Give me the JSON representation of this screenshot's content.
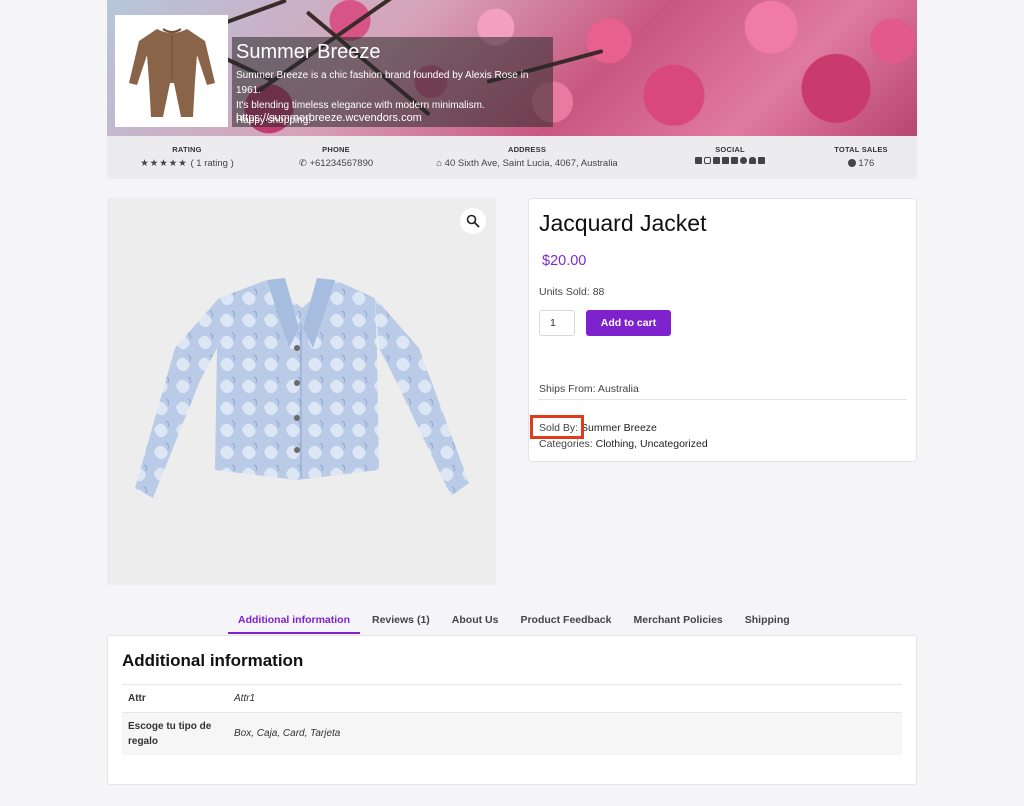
{
  "store": {
    "name": "Summer Breeze",
    "description_lines": [
      " Summer Breeze is a chic fashion brand founded by Alexis Rose in 1961.",
      "It's blending timeless elegance with modern minimalism.",
      "Happy shopping!"
    ],
    "url": "https://summerbreeze.wcvendors.com"
  },
  "info": {
    "rating_label": "RATING",
    "rating_text": "( 1 rating )",
    "rating_stars": 5,
    "phone_label": "PHONE",
    "phone": "+61234567890",
    "address_label": "ADDRESS",
    "address": "40 Sixth Ave, Saint Lucia, 4067, Australia",
    "social_label": "SOCIAL",
    "total_sales_label": "TOTAL SALES",
    "total_sales": "176"
  },
  "product": {
    "title": "Jacquard Jacket",
    "price": "$20.00",
    "units_sold": "Units Sold: 88",
    "quantity": "1",
    "add_to_cart": "Add to cart",
    "ships_from": "Ships From: Australia",
    "sold_by_label": "Sold By:",
    "sold_by_value": "Summer Breeze",
    "categories_label": "Categories:",
    "categories_value": "Clothing, Uncategorized"
  },
  "tabs": [
    {
      "label": "Additional information",
      "active": true
    },
    {
      "label": "Reviews (1)"
    },
    {
      "label": "About Us"
    },
    {
      "label": "Product Feedback"
    },
    {
      "label": "Merchant Policies"
    },
    {
      "label": "Shipping"
    }
  ],
  "additional_info": {
    "title": "Additional information",
    "rows": [
      {
        "key": "Attr",
        "value": "Attr1"
      },
      {
        "key": "Escoge tu tipo de regalo",
        "value": "Box, Caja, Card, Tarjeta"
      }
    ]
  },
  "colors": {
    "accent": "#7e22ce",
    "highlight_box": "#e23b1b"
  }
}
